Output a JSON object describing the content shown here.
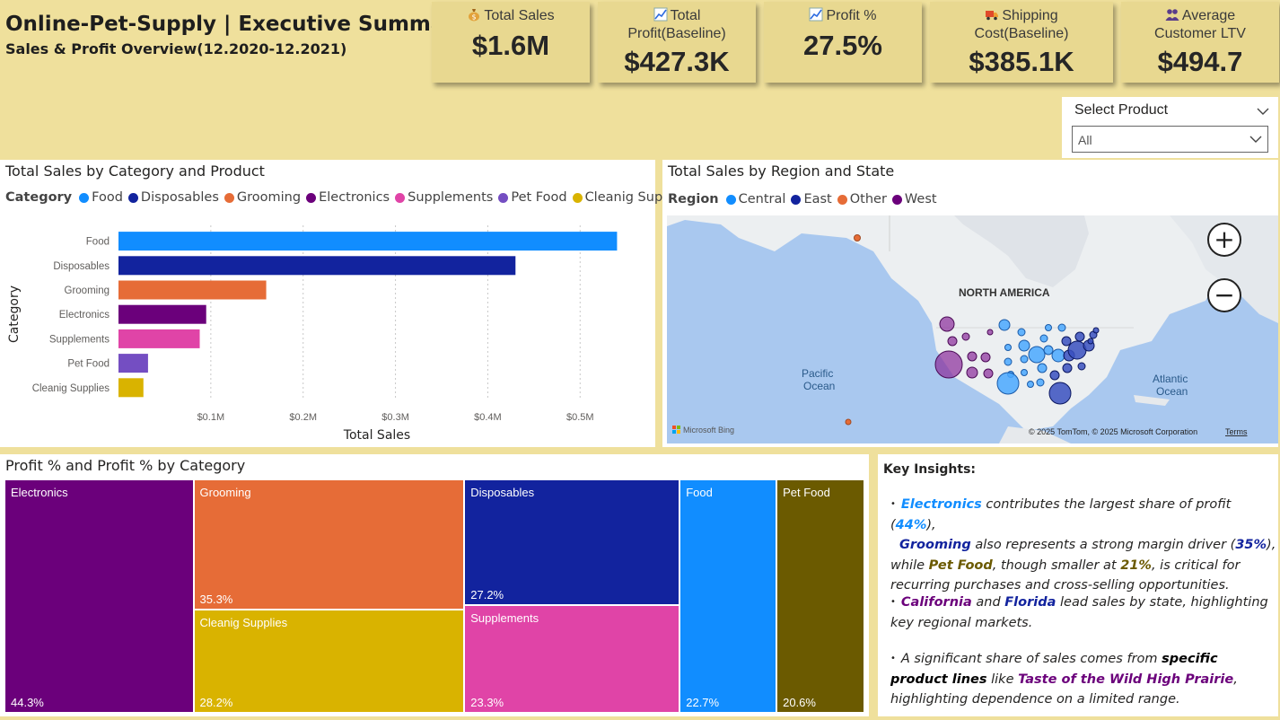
{
  "header": {
    "title": "Online-Pet-Supply | Executive Summary",
    "subtitle": "Sales & Profit Overview(12.2020-12.2021)"
  },
  "kpis": [
    {
      "icon": "money-bag-icon",
      "label": "Total Sales",
      "value": "$1.6M"
    },
    {
      "icon": "trend-chart-icon",
      "label": "Total Profit(Baseline)",
      "value": "$427.3K"
    },
    {
      "icon": "trend-chart-icon",
      "label": "Profit %",
      "value": "27.5%"
    },
    {
      "icon": "truck-icon",
      "label": "Shipping Cost(Baseline)",
      "value": "$385.1K"
    },
    {
      "icon": "people-icon",
      "label": "Average Customer LTV",
      "value": "$494.7"
    }
  ],
  "slicer": {
    "title": "Select Product",
    "value": "All"
  },
  "bar_panel": {
    "title": "Total Sales by Category and Product",
    "legend_title": "Category",
    "legend": [
      {
        "name": "Food",
        "color": "#118dff"
      },
      {
        "name": "Disposables",
        "color": "#12239e"
      },
      {
        "name": "Grooming",
        "color": "#e66c37"
      },
      {
        "name": "Electronics",
        "color": "#6b007b"
      },
      {
        "name": "Supplements",
        "color": "#e044a7"
      },
      {
        "name": "Pet Food",
        "color": "#744ec2"
      },
      {
        "name": "Cleanig Supplies",
        "color": "#d9b300"
      }
    ]
  },
  "map_panel": {
    "title": "Total Sales by Region and State",
    "legend_title": "Region",
    "legend": [
      {
        "name": "Central",
        "color": "#118dff"
      },
      {
        "name": "East",
        "color": "#12239e"
      },
      {
        "name": "Other",
        "color": "#e66c37"
      },
      {
        "name": "West",
        "color": "#6b007b"
      }
    ],
    "labels": {
      "continent": "NORTH AMERICA",
      "pacific_1": "Pacific",
      "pacific_2": "Ocean",
      "atlantic_1": "Atlantic",
      "atlantic_2": "Ocean"
    },
    "bing": "Microsoft Bing",
    "copyright": "© 2025 TomTom, © 2025 Microsoft Corporation",
    "terms": "Terms",
    "zoom_in": "+",
    "zoom_out": "−"
  },
  "treemap_panel": {
    "title": "Profit % and Profit % by Category"
  },
  "insights": {
    "heading": "Key Insights:",
    "p1": {
      "b1": "Electronics",
      "t1": " contributes the largest share of profit (",
      "b2": "44%",
      "t2": "),",
      "b3": "Grooming",
      "t3": " also represents a strong margin driver (",
      "b4": "35%",
      "t4": "), while ",
      "b5": "Pet Food",
      "t5": ", though smaller at ",
      "b6": "21%",
      "t6": ", is critical for recurring purchases and cross-selling opportunities."
    },
    "p2": {
      "b1": "California",
      "t1": " and ",
      "b2": "Florida",
      "t2": " lead sales by state, highlighting key regional markets."
    },
    "p3": {
      "t1": "A significant share of sales comes from ",
      "b1": "specific product lines",
      "t2": " like ",
      "b2": "Taste of the Wild High Prairie",
      "t3": ", highlighting dependence on a limited range."
    }
  },
  "chart_data": [
    {
      "type": "bar",
      "orientation": "horizontal",
      "title": "Total Sales by Category and Product",
      "categories": [
        "Food",
        "Disposables",
        "Grooming",
        "Electronics",
        "Supplements",
        "Pet Food",
        "Cleanig Supplies"
      ],
      "values": [
        0.54,
        0.43,
        0.16,
        0.095,
        0.088,
        0.032,
        0.027
      ],
      "colors": [
        "#118dff",
        "#12239e",
        "#e66c37",
        "#6b007b",
        "#e044a7",
        "#744ec2",
        "#d9b300"
      ],
      "xlabel": "Total Sales",
      "ylabel": "Category",
      "xticks": [
        0.1,
        0.2,
        0.3,
        0.4,
        0.5
      ],
      "xtick_labels": [
        "$0.1M",
        "$0.2M",
        "$0.3M",
        "$0.4M",
        "$0.5M"
      ],
      "xlim": [
        0.0,
        0.56
      ],
      "grid": "vertical dotted"
    },
    {
      "type": "treemap",
      "title": "Profit % and Profit % by Category",
      "items": [
        {
          "name": "Electronics",
          "label": "44.3%",
          "value": 44.3,
          "color": "#6b007b"
        },
        {
          "name": "Grooming",
          "label": "35.3%",
          "value": 35.3,
          "color": "#e66c37"
        },
        {
          "name": "Cleanig Supplies",
          "label": "28.2%",
          "value": 28.2,
          "color": "#d9b300"
        },
        {
          "name": "Disposables",
          "label": "27.2%",
          "value": 27.2,
          "color": "#12239e"
        },
        {
          "name": "Supplements",
          "label": "23.3%",
          "value": 23.3,
          "color": "#e044a7"
        },
        {
          "name": "Food",
          "label": "22.7%",
          "value": 22.7,
          "color": "#118dff"
        },
        {
          "name": "Pet Food",
          "label": "20.6%",
          "value": 20.6,
          "color": "#6b5a00"
        }
      ]
    }
  ]
}
